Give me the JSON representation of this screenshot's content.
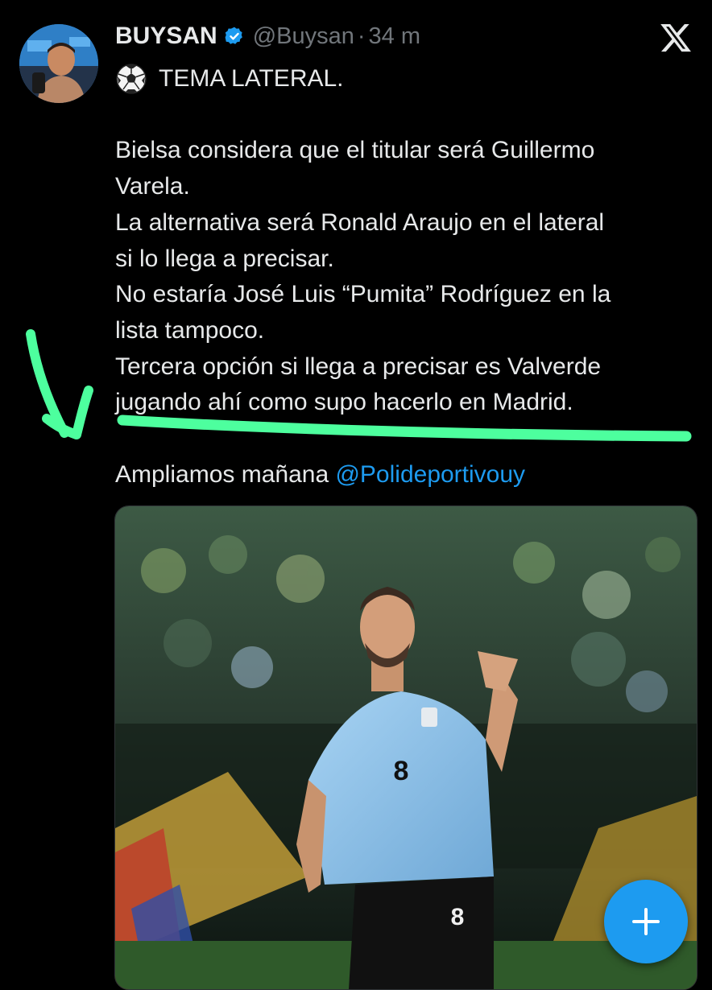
{
  "tweet": {
    "display_name": "BUYSAN",
    "handle": "@Buysan",
    "separator": "·",
    "time": "34 m",
    "lines": {
      "topic": "TEMA LATERAL.",
      "l1": "Bielsa considera que el titular será Guillermo",
      "l2": "Varela.",
      "l3": "La alternativa será Ronald Araujo en el lateral",
      "l4": "si lo llega a precisar.",
      "l5": "No estaría José Luis “Pumita” Rodríguez en la",
      "l6": "lista tampoco.",
      "l7": "Tercera opción si llega a precisar es Valverde",
      "l8": "jugando ahí como supo hacerlo en Madrid.",
      "closing": "Ampliamos mañana ",
      "mention": "@Polideportivouy"
    }
  },
  "media": {
    "shirt_number": "8"
  },
  "colors": {
    "accent": "#1d9bf0",
    "annotation": "#4dff9e",
    "shirt": "#8ec2ea"
  },
  "icons": {
    "verified": "verified-badge-icon",
    "logo": "x-logo-icon",
    "ball": "soccer-ball-icon",
    "compose": "plus-icon"
  }
}
